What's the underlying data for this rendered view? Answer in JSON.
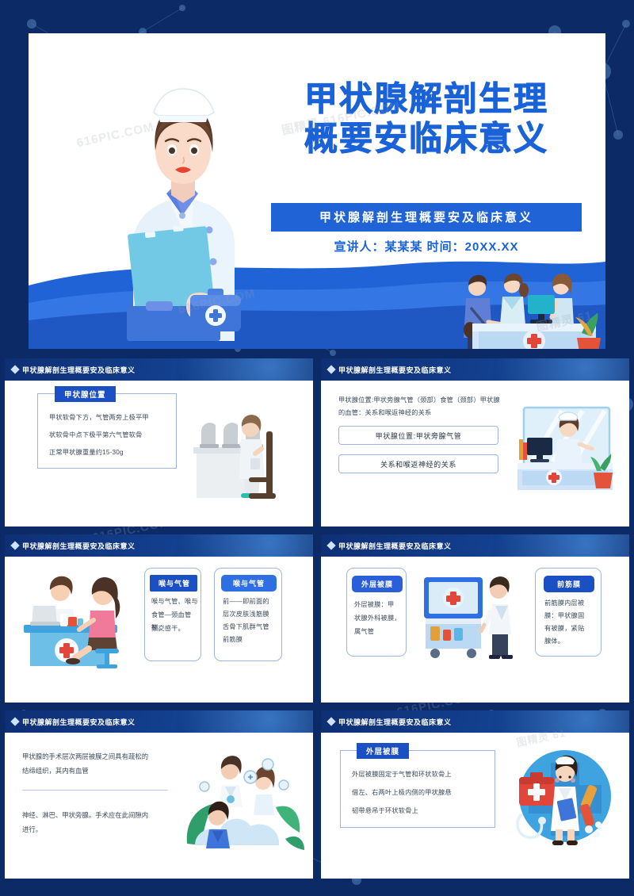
{
  "cover": {
    "title_lines": [
      "甲状腺解剖生理",
      "概要安临床意义"
    ],
    "subtitle": "甲状腺解剖生理概要安及临床意义",
    "presenter_line": "宣讲人：某某某  时间：20XX.XX",
    "watermarks": [
      "图精灵 616PIC.COM",
      "616PIC.COM",
      "图精灵 61"
    ],
    "illustrations": {
      "nurse": "nurse-with-clipboard-illustration",
      "kit": "medical-kit-icon",
      "reception": "hospital-reception-desk-illustration"
    },
    "colors": {
      "title": "#1a62d8",
      "subtitle_bg": "#1f63d6",
      "panel_bg": "#ffffff"
    }
  },
  "slides": [
    {
      "header": "甲状腺解剖生理概要安及临床意义",
      "badge": "甲状腺位置",
      "lines": [
        "甲状软骨下方，气管两旁上极平甲",
        "状软骨中点下极平第六气管软骨",
        "正常甲状腺重量约15-30g"
      ],
      "illustration": "lab-scientist-microscope-illustration"
    },
    {
      "header": "甲状腺解剖生理概要安及临床意义",
      "lines": [
        "甲状腺位置:甲状旁腺气管（颈部）食管（颈部）甲状腺",
        "的血管：关系和喉返神经的关系"
      ],
      "pills": [
        "甲状腺位置:甲状旁腺气管",
        "关系和喉返神经的关系"
      ],
      "illustration": "nurse-reception-counter-illustration"
    },
    {
      "header": "甲状腺解剖生理概要安及临床意义",
      "cards": [
        {
          "badge": "喉与气管",
          "badge_shape": "square",
          "badge_color": "#1b4fc4",
          "lines": [
            "喉与气管、喉与",
            "食管—颈血管鞘、",
            "颈交感干。"
          ]
        },
        {
          "badge": "喉与气管",
          "badge_shape": "round",
          "badge_color": "#2f6fe4",
          "lines": [
            "前——即前面的",
            "层次皮肤浅筋膜",
            "舌骨下肌群气管",
            "前筋膜"
          ]
        }
      ],
      "illustration": "doctor-patient-consultation-illustration"
    },
    {
      "header": "甲状腺解剖生理概要安及临床意义",
      "cards": [
        {
          "badge": "外层被膜",
          "badge_shape": "round",
          "badge_color": "#2b5fd9",
          "lines": [
            "外层被膜：甲",
            "状腺外科被膜，",
            "属气管"
          ]
        },
        {
          "badge": "前筋膜",
          "badge_shape": "round",
          "badge_color": "#1b4fc4",
          "lines": [
            "前筋膜内层被",
            "膜：甲状腺固",
            "有被膜，紧贴",
            "腺体。"
          ]
        }
      ],
      "illustration": "doctor-medical-cart-illustration"
    },
    {
      "header": "甲状腺解剖生理概要安及临床意义",
      "paragraphs": [
        [
          "甲状腺的手术层次两层被膜之间具有疏松的",
          "结缔组织，其内有血管"
        ],
        [
          "神经、淋巴、甲状旁腺。手术应在此间隙内",
          "进行。"
        ]
      ],
      "illustration": "doctors-team-leaves-illustration"
    },
    {
      "header": "甲状腺解剖生理概要安及临床意义",
      "badge": "外层被膜",
      "lines": [
        "外层被膜固定于气管和环状软骨上",
        "借左、右两叶上极内侧的甲状腺悬",
        "韧带悬吊于环状软骨上"
      ],
      "illustration": "nurse-medical-kit-circle-illustration"
    }
  ]
}
